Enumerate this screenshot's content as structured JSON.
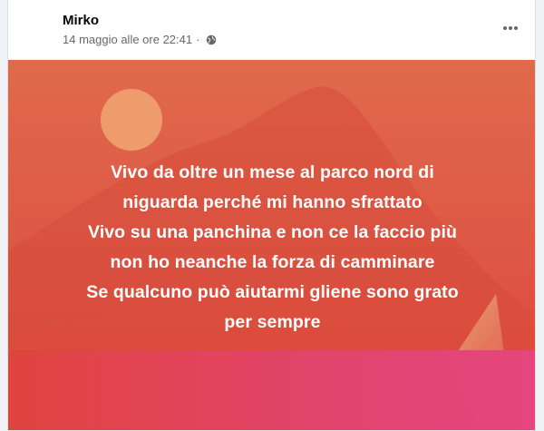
{
  "post": {
    "author": "Mirko",
    "timestamp": "14 maggio alle ore 22:41",
    "privacy_icon": "globe-icon",
    "more_icon": "more-options-icon",
    "lines": [
      "Vivo da oltre un mese al parco nord di",
      "niguarda perché mi hanno sfrattato",
      "Vivo su una panchina e non ce la faccio più",
      "non ho neanche la forza di camminare",
      "Se qualcuno può aiutarmi gliene sono grato",
      "per sempre"
    ]
  },
  "theme": {
    "text_color": "#ffffff",
    "bg_top": "#df6346",
    "bg_mid": "#dd4a3e",
    "bg_bottom": "#e2407a",
    "sun_color": "#ee9a6a"
  }
}
